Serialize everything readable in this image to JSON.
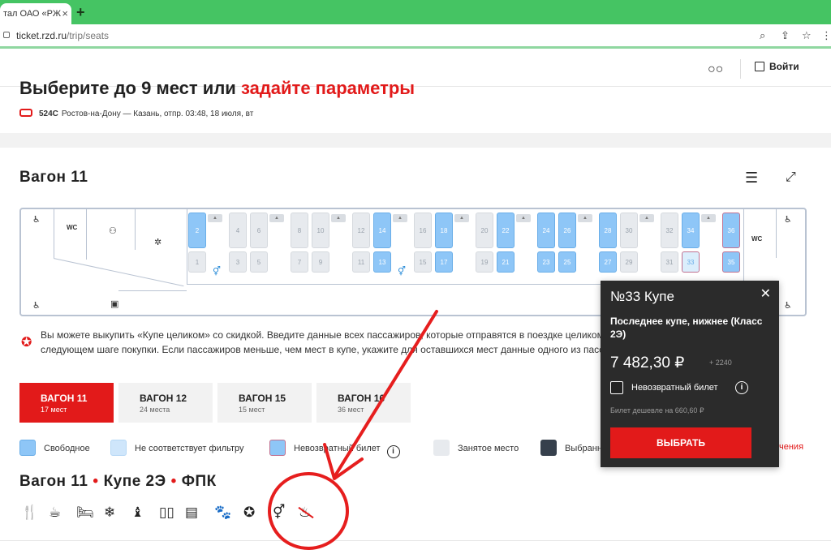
{
  "browser": {
    "tab_title": "тал ОАО «РЖ",
    "tab_close": "×",
    "new_tab": "+",
    "url_host": "ticket.rzd.ru",
    "url_path": "/trip/seats"
  },
  "header": {
    "login": "Войти"
  },
  "page": {
    "title_main": "Выберите до 9 мест",
    "title_or": " или ",
    "title_link": "задайте параметры",
    "train_number": "524С",
    "train_route": "Ростов-на-Дону — Казань,  отпр. 03:48, 18 июля, вт"
  },
  "wagon": {
    "title": "Вагон 11",
    "wc_label": "WC",
    "seats_top": [
      {
        "n": "2",
        "s": "free"
      },
      {
        "n": "4",
        "s": "busy"
      },
      {
        "n": "6",
        "s": "busy"
      },
      {
        "n": "8",
        "s": "busy"
      },
      {
        "n": "10",
        "s": "busy"
      },
      {
        "n": "12",
        "s": "busy"
      },
      {
        "n": "14",
        "s": "free"
      },
      {
        "n": "16",
        "s": "busy"
      },
      {
        "n": "18",
        "s": "free"
      },
      {
        "n": "20",
        "s": "busy"
      },
      {
        "n": "22",
        "s": "free"
      },
      {
        "n": "24",
        "s": "free"
      },
      {
        "n": "26",
        "s": "free"
      },
      {
        "n": "28",
        "s": "free"
      },
      {
        "n": "30",
        "s": "busy"
      },
      {
        "n": "32",
        "s": "busy"
      },
      {
        "n": "34",
        "s": "free"
      },
      {
        "n": "36",
        "s": "nr"
      }
    ],
    "seats_bottom": [
      {
        "n": "1",
        "s": "busy"
      },
      {
        "n": "3",
        "s": "busy"
      },
      {
        "n": "5",
        "s": "busy"
      },
      {
        "n": "7",
        "s": "busy"
      },
      {
        "n": "9",
        "s": "busy"
      },
      {
        "n": "11",
        "s": "busy"
      },
      {
        "n": "13",
        "s": "free"
      },
      {
        "n": "15",
        "s": "busy"
      },
      {
        "n": "17",
        "s": "free"
      },
      {
        "n": "19",
        "s": "busy"
      },
      {
        "n": "21",
        "s": "free"
      },
      {
        "n": "23",
        "s": "free"
      },
      {
        "n": "25",
        "s": "free"
      },
      {
        "n": "27",
        "s": "free"
      },
      {
        "n": "29",
        "s": "busy"
      },
      {
        "n": "31",
        "s": "busy"
      },
      {
        "n": "33",
        "s": "sel"
      },
      {
        "n": "35",
        "s": "nr"
      }
    ]
  },
  "info": {
    "text": "Вы можете выкупить «Купе целиком» со скидкой. Введите данные всех пассажиров, которые отправятся в поездке целиком». Цена за купе будет показана на следующем шаге покупки. Если пассажиров меньше, чем мест в купе, укажите для оставшихся мест данные одного из пассажиров повторно."
  },
  "wagon_tabs": [
    {
      "title": "ВАГОН 11",
      "sub": "17 мест"
    },
    {
      "title": "ВАГОН 12",
      "sub": "24 места"
    },
    {
      "title": "ВАГОН 15",
      "sub": "15 мест"
    },
    {
      "title": "ВАГОН 16",
      "sub": "36 мест"
    }
  ],
  "legend": {
    "free": "Свободное",
    "nofilter": "Не соответствует фильтру",
    "nonrefund": "Невозвратный билет",
    "help": "i",
    "busy": "Занятое место",
    "selected": "Выбранное",
    "tail": "чения",
    "colors": {
      "free": "#8ec6f7",
      "nofilter": "#cfe6fb",
      "busy": "#e7eaee",
      "selected": "#36404c",
      "accent": "#e21a1a"
    }
  },
  "coupe": {
    "wagon": "Вагон 11",
    "class": "Купе 2Э",
    "carrier": "ФПК",
    "dot": "•",
    "amenities": [
      "fork-knife-icon",
      "coffee-icon",
      "bed-icon",
      "snowflake-icon",
      "toilet-icon",
      "bottles-icon",
      "newspaper-icon",
      "paw-icon",
      "star-badge-icon",
      "wc-icon",
      "no-smoking-icon"
    ]
  },
  "popup": {
    "title": "№33 Купе",
    "close": "✕",
    "desc": "Последнее купе, нижнее (Класс 2Э)",
    "price": "7 482,30 ₽",
    "bonus": "+ 2240",
    "nonrefund_label": "Невозвратный билет",
    "info": "i",
    "cheaper": "Билет дешевле на 660,60 ₽",
    "select": "ВЫБРАТЬ"
  }
}
